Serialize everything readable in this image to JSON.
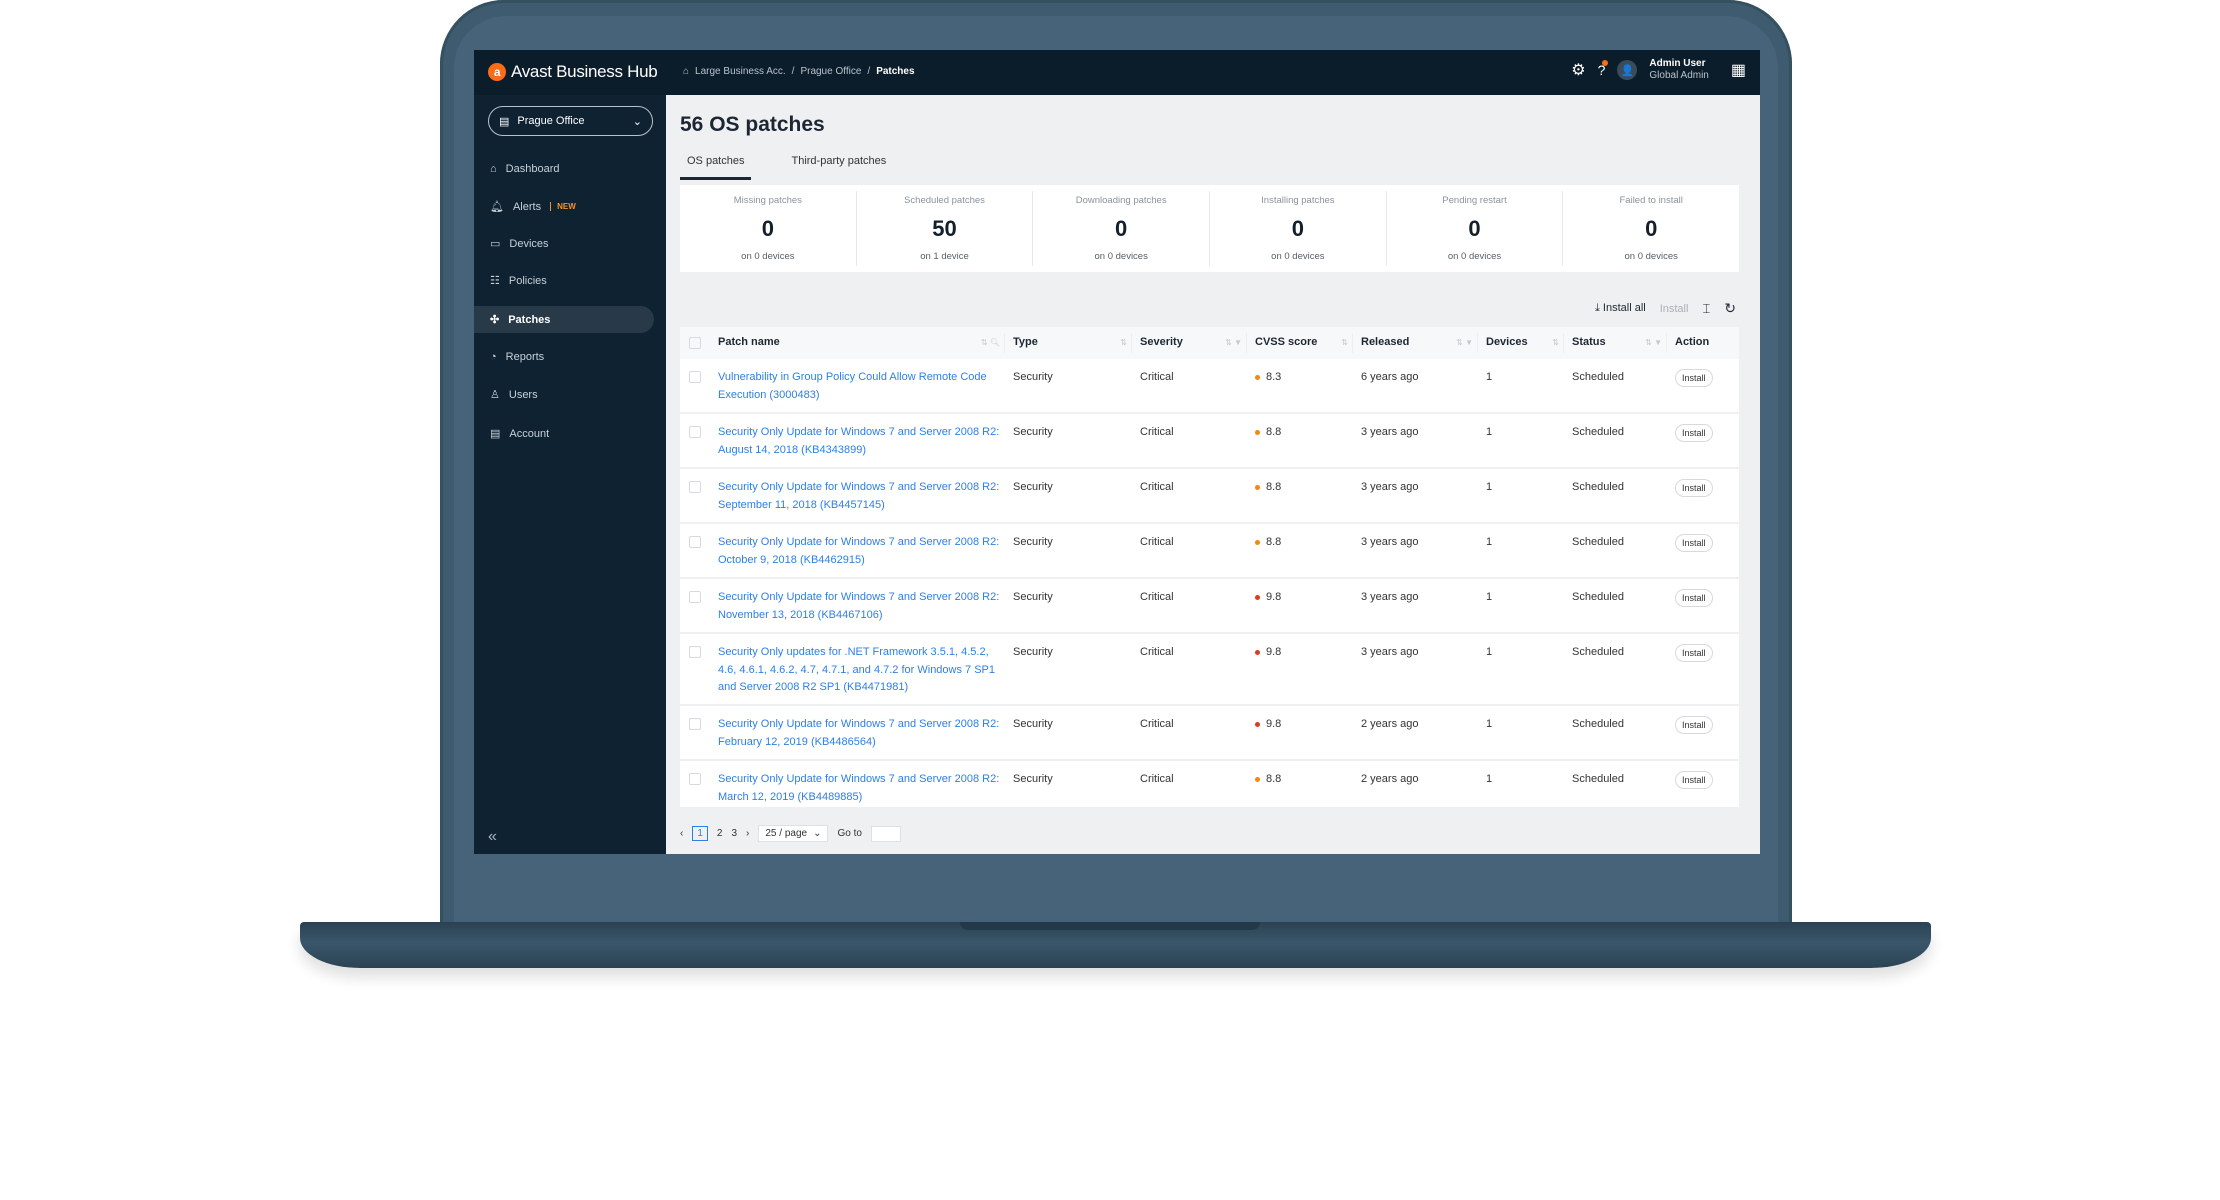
{
  "app": {
    "name": "Avast Business Hub",
    "brand_color": "#f96d16"
  },
  "breadcrumb": [
    "Large Business Acc.",
    "Prague Office",
    "Patches"
  ],
  "user": {
    "name": "Admin User",
    "role": "Global Admin"
  },
  "location": "Prague Office",
  "sidebar": {
    "items": [
      {
        "label": "Dashboard",
        "icon": "home-icon"
      },
      {
        "label": "Alerts",
        "icon": "bell-icon",
        "badge": "NEW"
      },
      {
        "label": "Devices",
        "icon": "monitor-icon"
      },
      {
        "label": "Policies",
        "icon": "policies-icon"
      },
      {
        "label": "Patches",
        "icon": "patches-icon",
        "active": true
      },
      {
        "label": "Reports",
        "icon": "reports-icon"
      },
      {
        "label": "Users",
        "icon": "user-icon"
      },
      {
        "label": "Account",
        "icon": "account-icon"
      }
    ]
  },
  "page": {
    "title": "56 OS patches",
    "tabs": [
      "OS patches",
      "Third-party patches"
    ],
    "active_tab": "OS patches"
  },
  "stats": [
    {
      "label": "Missing patches",
      "value": "0",
      "sub": "on 0 devices"
    },
    {
      "label": "Scheduled patches",
      "value": "50",
      "sub": "on 1 device"
    },
    {
      "label": "Downloading patches",
      "value": "0",
      "sub": "on 0 devices"
    },
    {
      "label": "Installing patches",
      "value": "0",
      "sub": "on 0 devices"
    },
    {
      "label": "Pending restart",
      "value": "0",
      "sub": "on 0 devices"
    },
    {
      "label": "Failed to install",
      "value": "0",
      "sub": "on 0 devices"
    }
  ],
  "toolbar": {
    "install_all": "Install all",
    "install": "Install"
  },
  "table": {
    "columns": [
      "Patch name",
      "Type",
      "Severity",
      "CVSS score",
      "Released",
      "Devices",
      "Status",
      "Action"
    ],
    "rows": [
      {
        "name": "Vulnerability in Group Policy Could Allow Remote Code Execution (3000483)",
        "type": "Security",
        "severity": "Critical",
        "cvss": "8.3",
        "cvss_color": "#f7860f",
        "released": "6 years ago",
        "devices": "1",
        "status": "Scheduled",
        "action": "Install"
      },
      {
        "name": "Security Only Update for Windows 7 and Server 2008 R2: August 14, 2018 (KB4343899)",
        "type": "Security",
        "severity": "Critical",
        "cvss": "8.8",
        "cvss_color": "#f7860f",
        "released": "3 years ago",
        "devices": "1",
        "status": "Scheduled",
        "action": "Install"
      },
      {
        "name": "Security Only Update for Windows 7 and Server 2008 R2: September 11, 2018 (KB4457145)",
        "type": "Security",
        "severity": "Critical",
        "cvss": "8.8",
        "cvss_color": "#f7860f",
        "released": "3 years ago",
        "devices": "1",
        "status": "Scheduled",
        "action": "Install"
      },
      {
        "name": "Security Only Update for Windows 7 and Server 2008 R2: October 9, 2018 (KB4462915)",
        "type": "Security",
        "severity": "Critical",
        "cvss": "8.8",
        "cvss_color": "#f7860f",
        "released": "3 years ago",
        "devices": "1",
        "status": "Scheduled",
        "action": "Install"
      },
      {
        "name": "Security Only Update for Windows 7 and Server 2008 R2: November 13, 2018 (KB4467106)",
        "type": "Security",
        "severity": "Critical",
        "cvss": "9.8",
        "cvss_color": "#e03a1e",
        "released": "3 years ago",
        "devices": "1",
        "status": "Scheduled",
        "action": "Install"
      },
      {
        "name": "Security Only updates for .NET Framework 3.5.1, 4.5.2, 4.6, 4.6.1, 4.6.2, 4.7, 4.7.1, and 4.7.2 for Windows 7 SP1 and Server 2008 R2 SP1 (KB4471981)",
        "type": "Security",
        "severity": "Critical",
        "cvss": "9.8",
        "cvss_color": "#e03a1e",
        "released": "3 years ago",
        "devices": "1",
        "status": "Scheduled",
        "action": "Install"
      },
      {
        "name": "Security Only Update for Windows 7 and Server 2008 R2: February 12, 2019 (KB4486564)",
        "type": "Security",
        "severity": "Critical",
        "cvss": "9.8",
        "cvss_color": "#e03a1e",
        "released": "2 years ago",
        "devices": "1",
        "status": "Scheduled",
        "action": "Install"
      },
      {
        "name": "Security Only Update for Windows 7 and Server 2008 R2: March 12, 2019 (KB4489885)",
        "type": "Security",
        "severity": "Critical",
        "cvss": "8.8",
        "cvss_color": "#f7860f",
        "released": "2 years ago",
        "devices": "1",
        "status": "Scheduled",
        "action": "Install"
      }
    ]
  },
  "pagination": {
    "pages": [
      "1",
      "2",
      "3"
    ],
    "current": "1",
    "page_size": "25 / page",
    "goto_label": "Go to"
  }
}
